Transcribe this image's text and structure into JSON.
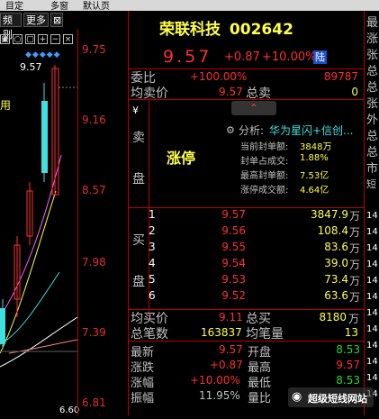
{
  "top_bar": {
    "items": [
      "目定",
      "多窗",
      "默认页"
    ]
  },
  "left_toolbar": {
    "btn1": "频则",
    "btn2": "更多"
  },
  "left_chart": {
    "price_marker": "9.57",
    "y_ticks": [
      "9.75",
      "9.16",
      "8.57",
      "7.98",
      "7.39",
      "6.81"
    ],
    "side_label": "用",
    "bottom_label": "6.60"
  },
  "stock": {
    "name": "荣联科技",
    "code": "002642"
  },
  "price_line": {
    "price": "9.57",
    "change": "+0.87",
    "pct": "+10.00%",
    "tag": "陆"
  },
  "order_ratio": {
    "label": "委比",
    "pct": "+100.00%",
    "diff": "89787"
  },
  "avg_ask": {
    "label": "均卖价",
    "value": "9.57",
    "total_label": "总卖",
    "total": "0"
  },
  "sell_panel": {
    "yen": "¥",
    "side_chars": [
      "卖",
      "盘"
    ],
    "limit_up": "涨停",
    "analysis_label": "分析:",
    "analysis_value": "华为星闪+信创...",
    "lines": [
      {
        "label": "当前封单额:",
        "value": "3848万"
      },
      {
        "label": "封单占成交:",
        "value": "1.88%"
      },
      {
        "label": "最高封单额:",
        "value": "7.53亿"
      },
      {
        "label": "涨停成交额:",
        "value": "4.64亿"
      }
    ]
  },
  "buy_side": {
    "side_chars": [
      "买",
      "盘"
    ]
  },
  "buy_book": [
    {
      "idx": "1",
      "price": "9.57",
      "vol": "3847.9",
      "unit": "万"
    },
    {
      "idx": "2",
      "price": "9.56",
      "vol": "108.4",
      "unit": "万"
    },
    {
      "idx": "3",
      "price": "9.55",
      "vol": "83.6",
      "unit": "万"
    },
    {
      "idx": "4",
      "price": "9.54",
      "vol": "39.0",
      "unit": "万"
    },
    {
      "idx": "5",
      "price": "9.53",
      "vol": "73.4",
      "unit": "万"
    },
    {
      "idx": "6",
      "price": "9.52",
      "vol": "63.6",
      "unit": "万"
    }
  ],
  "avg_bid": {
    "label": "均买价",
    "value": "9.11",
    "total_label": "总买",
    "total": "8180",
    "unit": "万"
  },
  "trades": {
    "label": "总笔数",
    "value": "163837",
    "avg_label": "均笔量",
    "avg": "13"
  },
  "stats": [
    {
      "l": "最新",
      "v": "9.57",
      "l2": "开盘",
      "v2": "8.53"
    },
    {
      "l": "涨跌",
      "v": "+0.87",
      "l2": "最高",
      "v2": "9.57"
    },
    {
      "l": "涨幅",
      "v": "+10.00%",
      "l2": "最低",
      "v2": "8.53"
    },
    {
      "l": "振幅",
      "v": "11.95%",
      "l2": "量比",
      "v2": ""
    }
  ],
  "right_strip": {
    "chars": [
      "最",
      "涨",
      "张",
      "总",
      "总",
      "张",
      "外",
      "总",
      "总",
      "市",
      "短",
      "14",
      "14",
      "14",
      "14",
      "14",
      "14",
      "14",
      "14",
      "14",
      "14",
      "14",
      "14"
    ]
  },
  "watermark": {
    "text": "超级短线网站"
  }
}
